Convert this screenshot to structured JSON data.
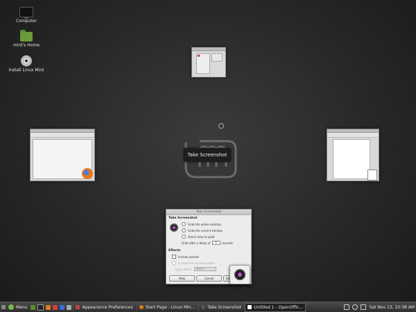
{
  "desktop": {
    "icons": [
      {
        "label": "Computer"
      },
      {
        "label": "mint's Home"
      },
      {
        "label": "Install Linux Mint"
      }
    ]
  },
  "tooltip": "Take Screenshot",
  "dialog": {
    "title": "Take Screenshot",
    "section_take": "Take Screenshot",
    "opt_entire": "Grab the whole desktop",
    "opt_window": "Grab the current window",
    "opt_area": "Select area to grab",
    "delay_prefix": "Grab after a delay of",
    "delay_value": "0",
    "delay_suffix": "seconds",
    "section_effects": "Effects",
    "opt_pointer": "Include pointer",
    "opt_border": "Include the window border",
    "apply_effect_label": "Apply effect:",
    "apply_effect_value": "None",
    "help_btn": "Help",
    "cancel_btn": "Cancel",
    "take_btn": "Take"
  },
  "taskbar": {
    "menu_label": "Menu",
    "tasks": [
      {
        "label": "Appearance Preferences"
      },
      {
        "label": "Start Page - Linux Min..."
      },
      {
        "label": "Take Screenshot"
      },
      {
        "label": "Untitled 1 - OpenOffic..."
      }
    ],
    "clock": "Sat Nov 13, 10:38 AM"
  },
  "colors": {
    "mint_green": "#7ab848",
    "taskbar_bg": "#3a3a3a"
  }
}
